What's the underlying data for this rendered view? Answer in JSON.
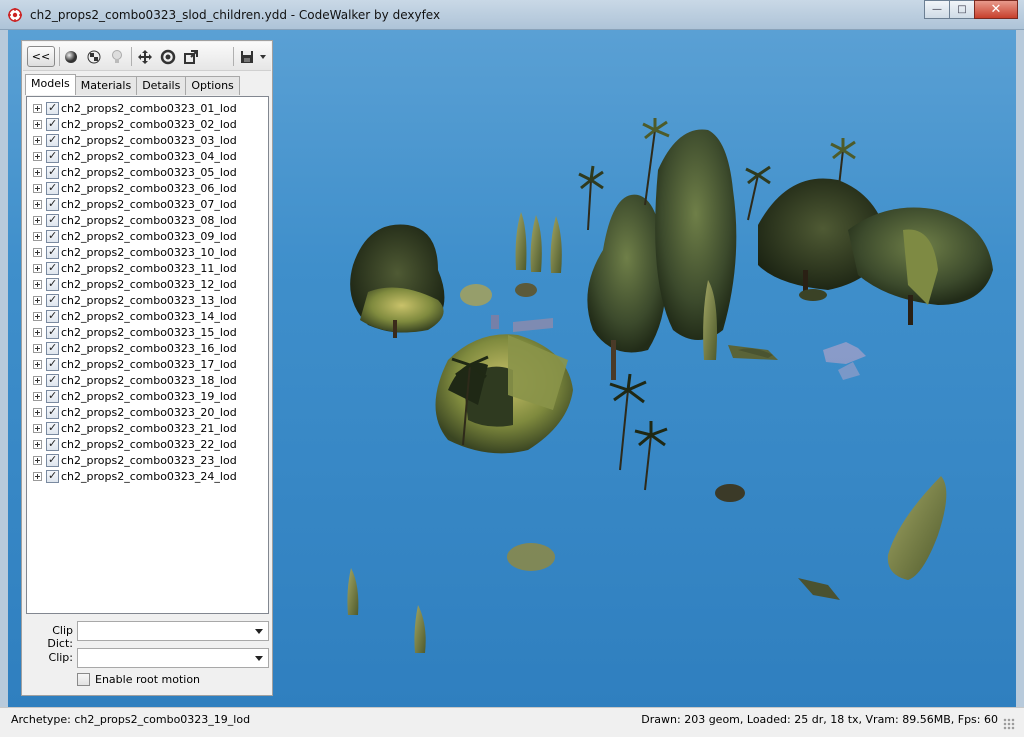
{
  "window": {
    "title": "ch2_props2_combo0323_slod_children.ydd - CodeWalker by dexyfex",
    "minimize_glyph": "—",
    "maximize_glyph": "□",
    "close_glyph": "✕"
  },
  "toolbar": {
    "collapse_label": "<<",
    "icons": [
      "sphere-icon",
      "checker-icon",
      "bulb-icon",
      "move-icon",
      "rotate-icon",
      "scale-icon",
      "save-icon",
      "dropdown-arrow-icon"
    ]
  },
  "tabs": [
    "Models",
    "Materials",
    "Details",
    "Options"
  ],
  "active_tab": "Models",
  "models": [
    "ch2_props2_combo0323_01_lod",
    "ch2_props2_combo0323_02_lod",
    "ch2_props2_combo0323_03_lod",
    "ch2_props2_combo0323_04_lod",
    "ch2_props2_combo0323_05_lod",
    "ch2_props2_combo0323_06_lod",
    "ch2_props2_combo0323_07_lod",
    "ch2_props2_combo0323_08_lod",
    "ch2_props2_combo0323_09_lod",
    "ch2_props2_combo0323_10_lod",
    "ch2_props2_combo0323_11_lod",
    "ch2_props2_combo0323_12_lod",
    "ch2_props2_combo0323_13_lod",
    "ch2_props2_combo0323_14_lod",
    "ch2_props2_combo0323_15_lod",
    "ch2_props2_combo0323_16_lod",
    "ch2_props2_combo0323_17_lod",
    "ch2_props2_combo0323_18_lod",
    "ch2_props2_combo0323_19_lod",
    "ch2_props2_combo0323_20_lod",
    "ch2_props2_combo0323_21_lod",
    "ch2_props2_combo0323_22_lod",
    "ch2_props2_combo0323_23_lod",
    "ch2_props2_combo0323_24_lod"
  ],
  "form": {
    "clip_dict_label": "Clip Dict:",
    "clip_dict_value": "",
    "clip_label": "Clip:",
    "clip_value": "",
    "root_motion_label": "Enable root motion",
    "root_motion_checked": false
  },
  "status": {
    "left": "Archetype: ch2_props2_combo0323_19_lod",
    "right": "Drawn: 203 geom, Loaded: 25 dr, 18 tx, Vram: 89.56MB, Fps: 60"
  },
  "colors": {
    "sky_top": "#5aa0d4",
    "sky_bottom": "#2f7fbf",
    "foliage_dark": "#2d3a22",
    "foliage_mid": "#5b6b34",
    "foliage_light": "#b7b45a"
  }
}
